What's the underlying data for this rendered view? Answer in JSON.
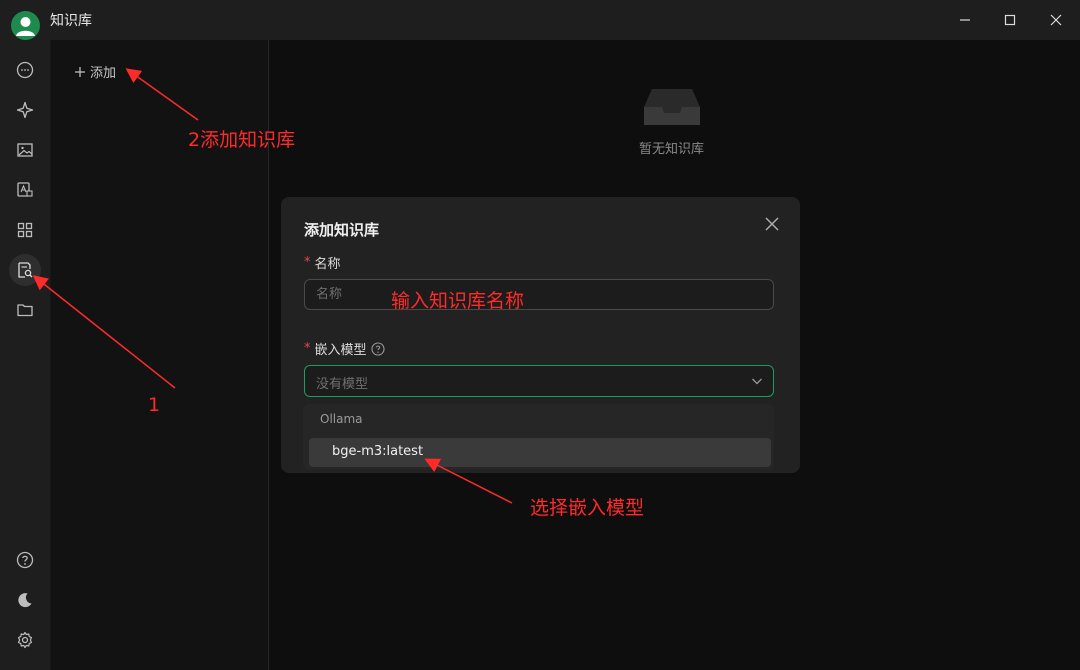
{
  "app": {
    "title": "知识库"
  },
  "list": {
    "add_label": "添加"
  },
  "main": {
    "empty_text": "暂无知识库"
  },
  "modal": {
    "title": "添加知识库",
    "name_label": "名称",
    "name_placeholder": "名称",
    "required_mark": "*",
    "model_label": "嵌入模型",
    "model_placeholder": "没有模型"
  },
  "dropdown": {
    "group": "Ollama",
    "options": [
      "bge-m3:latest"
    ]
  },
  "annotations": {
    "step1": "1",
    "step2": "2添加知识库",
    "name_hint": "输入知识库名称",
    "model_hint": "选择嵌入模型"
  },
  "colors": {
    "accent": "#1f9a63",
    "annotation": "#ff2a2a",
    "required": "#e34a4a"
  }
}
